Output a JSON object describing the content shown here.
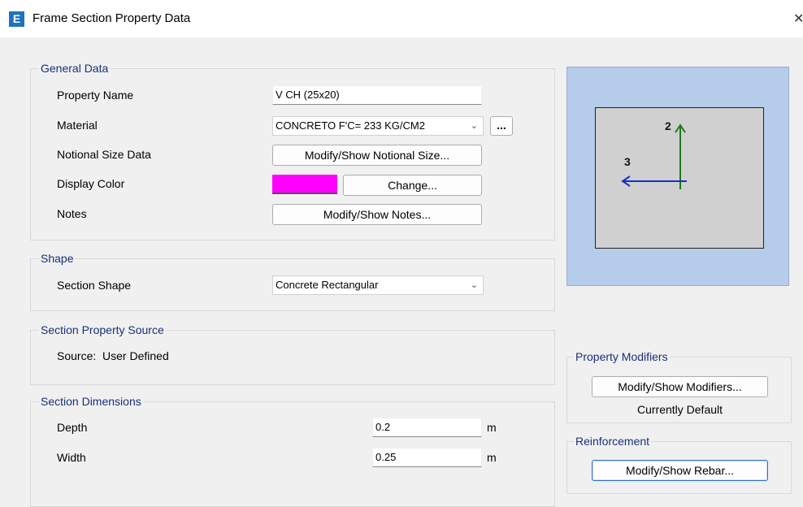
{
  "window": {
    "title": "Frame Section Property Data",
    "app_icon_letter": "E",
    "close_glyph": "✕"
  },
  "general": {
    "label": "General Data",
    "property_name_label": "Property Name",
    "property_name_value": "V CH (25x20)",
    "material_label": "Material",
    "material_value": "CONCRETO F'C= 233 KG/CM2",
    "material_browse": "...",
    "notional_label": "Notional Size Data",
    "notional_button": "Modify/Show Notional Size...",
    "color_label": "Display Color",
    "color_value": "#ff00ff",
    "change_button": "Change...",
    "notes_label": "Notes",
    "notes_button": "Modify/Show Notes..."
  },
  "shape": {
    "label": "Shape",
    "section_shape_label": "Section Shape",
    "section_shape_value": "Concrete Rectangular"
  },
  "source": {
    "label": "Section Property Source",
    "source_text": "Source:  User Defined"
  },
  "dimensions": {
    "label": "Section Dimensions",
    "depth_label": "Depth",
    "depth_value": "0.2",
    "depth_unit": "m",
    "width_label": "Width",
    "width_value": "0.25",
    "width_unit": "m"
  },
  "preview": {
    "axis2": "2",
    "axis3": "3"
  },
  "modifiers": {
    "label": "Property Modifiers",
    "button": "Modify/Show Modifiers...",
    "status": "Currently Default"
  },
  "reinforcement": {
    "label": "Reinforcement",
    "button": "Modify/Show Rebar..."
  },
  "colors": {
    "group_label": "#1a2f7a",
    "axis2": "#1a7a1a",
    "axis3": "#1a2fc8",
    "preview_bg": "#b5cdea"
  }
}
